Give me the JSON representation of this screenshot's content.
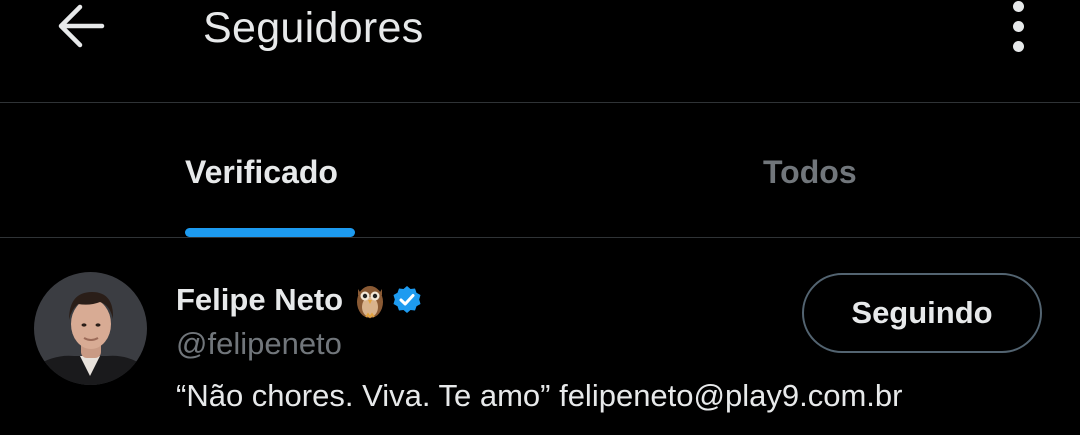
{
  "header": {
    "title": "Seguidores",
    "back_icon": "arrow-left-icon",
    "more_icon": "more-vertical-icon"
  },
  "tabs": [
    {
      "label": "Verificado",
      "selected": true
    },
    {
      "label": "Todos",
      "selected": false
    }
  ],
  "colors": {
    "background": "#000000",
    "text_primary": "#e7e9ea",
    "text_secondary": "#71767b",
    "accent": "#1d9bf0",
    "divider": "#2f3336",
    "button_border": "#536471"
  },
  "users": [
    {
      "name": "Felipe Neto",
      "name_emoji_icon": "owl-emoji-icon",
      "verified_icon": "verified-badge-icon",
      "handle": "@felipeneto",
      "bio": "“Não chores. Viva. Te amo” felipeneto@play9.com.br",
      "follow_button_label": "Seguindo"
    }
  ]
}
